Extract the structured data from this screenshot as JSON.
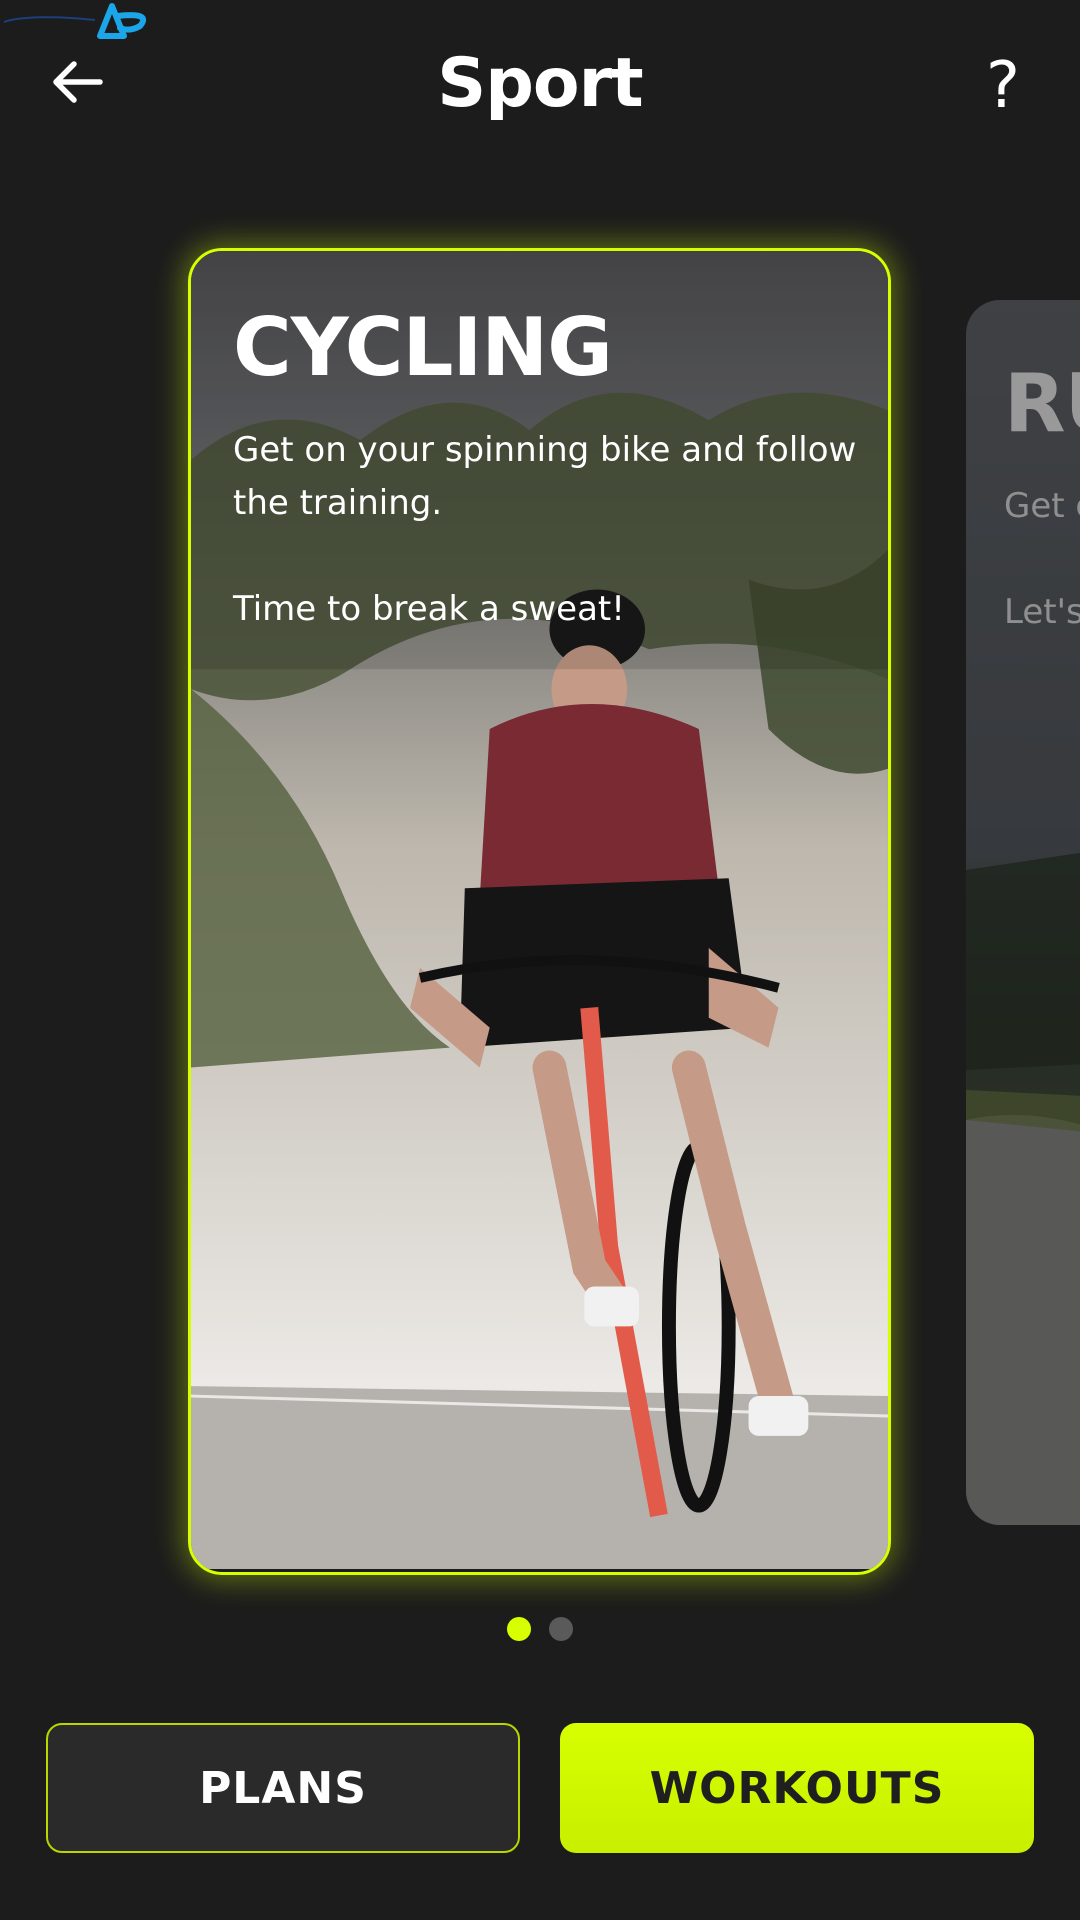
{
  "header": {
    "title": "Sport",
    "help_label": "?"
  },
  "icons": {
    "back": "back-arrow-icon",
    "watermark": "brand-logo"
  },
  "carousel": {
    "cards": [
      {
        "heading": "CYCLING",
        "description_1": "Get on your spinning bike and follow the training.",
        "description_2": "Time to break a sweat!",
        "image": "cyclist-on-road-photo"
      },
      {
        "heading": "RU",
        "description_1": "Get c going",
        "description_2": "Let's",
        "image": "runner-on-path-photo"
      }
    ],
    "active_index": 0,
    "count": 2
  },
  "buttons": {
    "plans_label": "PLANS",
    "workouts_label": "WORKOUTS"
  },
  "colors": {
    "accent": "#d7ff00",
    "background": "#1c1c1c",
    "dot_inactive": "#5a5a5a"
  }
}
